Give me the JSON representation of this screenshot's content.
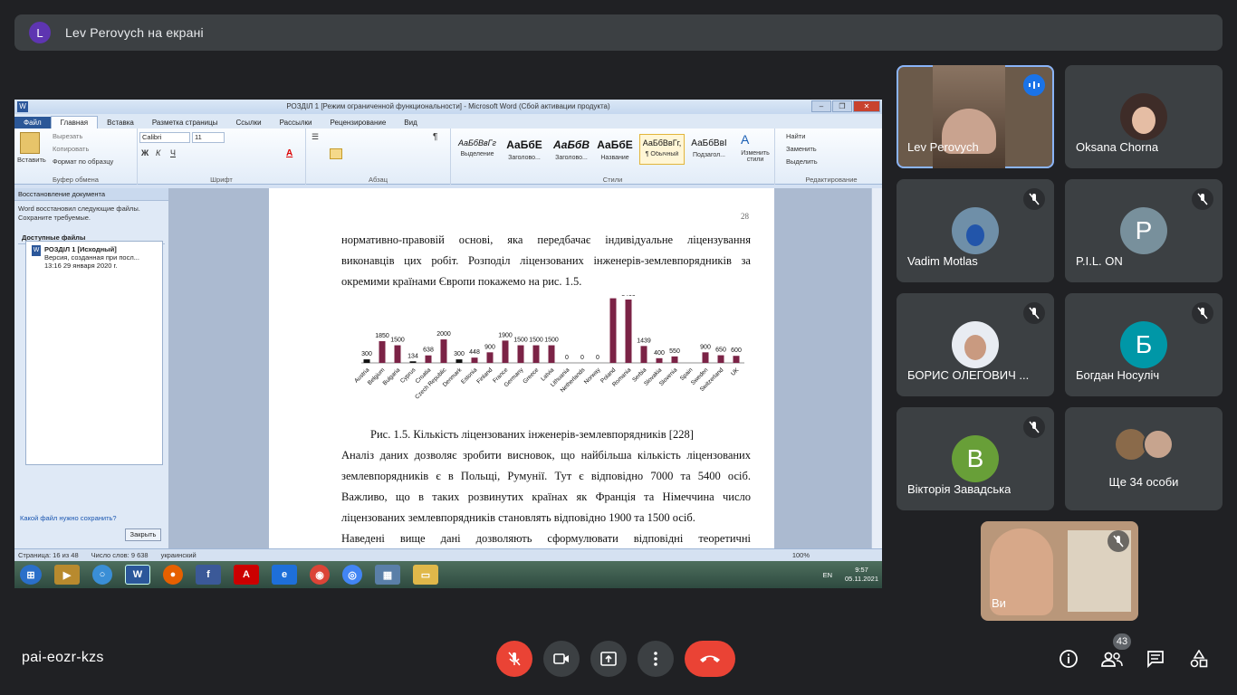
{
  "presenter": {
    "initial": "L",
    "text": "Lev Perovych на екрані"
  },
  "window": {
    "title": "РОЗДІЛ 1 [Режим ограниченной функциональности] - Microsoft Word (Сбой активации продукта)",
    "tabs": [
      "Файл",
      "Главная",
      "Вставка",
      "Разметка страницы",
      "Ссылки",
      "Рассылки",
      "Рецензирование",
      "Вид"
    ],
    "clipboard": {
      "paste": "Вставить",
      "cut": "Вырезать",
      "copy": "Копировать",
      "format": "Формат по образцу",
      "label": "Буфер обмена"
    },
    "font": {
      "name": "Calibri",
      "size": "11",
      "label": "Шрифт"
    },
    "paragraph_label": "Абзац",
    "styles": [
      {
        "preview": "АаБбВвГг",
        "name": "Выделение"
      },
      {
        "preview": "АаБбЕ",
        "name": "Заголово..."
      },
      {
        "preview": "АаБбВ",
        "name": "Заголово..."
      },
      {
        "preview": "АаБбЕ",
        "name": "Название"
      },
      {
        "preview": "АаБбВвГг,",
        "name": "¶ Обычный"
      },
      {
        "preview": "АаБбВвІ",
        "name": "Подзагол..."
      }
    ],
    "styles_label": "Стили",
    "change_styles": "Изменить стили",
    "editing": {
      "find": "Найти",
      "replace": "Заменить",
      "select": "Выделить",
      "label": "Редактирование"
    },
    "recovery": {
      "header": "Восстановление документа",
      "message": "Word восстановил следующие файлы. Сохраните требуемые.",
      "available": "Доступные файлы",
      "file_name": "РОЗДІЛ 1  [Исходный]",
      "file_desc": "Версия, созданная при посл...",
      "file_time": "13:16 29 января 2020 г.",
      "question": "Какой файл нужно сохранить?",
      "close": "Закрыть"
    },
    "document": {
      "page_number": "28",
      "lines_top": [
        "нормативно-правовій основі, яка передбачає індивідуальне ліцензування",
        "виконавців цих робіт. Розподіл ліцензованих інженерів-землевпорядників за",
        "окремими країнами Європи покажемо на рис. 1.5."
      ],
      "caption": "Рис. 1.5. Кількість ліцензованих інженерів-землевпорядників [228]",
      "lines_bottom": [
        "Аналіз даних дозволяє зробити висновок, що найбільша кількість ліцензованих",
        "землевпорядників є в Польщі, Румунії. Тут є відповідно 7000 та 5400 осіб.",
        "Важливо, що в таких розвинутих країнах як Франція та Німеччина число",
        "ліцензованих землевпорядників становлять відповідно 1900 та 1500 осіб.",
        "Наведені вище дані дозволяють сформулювати відповідні теоретичні"
      ]
    },
    "status": {
      "page": "Страница: 16 из 48",
      "words": "Число слов: 9 638",
      "lang": "украинский",
      "zoom": "100%"
    },
    "tray": {
      "lang": "EN",
      "time": "9:57",
      "date": "05.11.2021"
    }
  },
  "chart_data": {
    "type": "bar",
    "categories": [
      "Austria",
      "Belgium",
      "Bulgaria",
      "Cyprus",
      "Croatia",
      "Czech Republic",
      "Denmark",
      "Estonia",
      "Finland",
      "France",
      "Germany",
      "Greece",
      "Latvia",
      "Lithuania",
      "Netherlands",
      "Norway",
      "Poland",
      "Romania",
      "Serbia",
      "Slovakia",
      "Slovenia",
      "Spain",
      "Sweden",
      "Switzerland",
      "UK"
    ],
    "values": [
      300,
      1850,
      1500,
      134,
      638,
      2000,
      300,
      448,
      900,
      1900,
      1500,
      1500,
      1500,
      0,
      0,
      0,
      7000,
      5400,
      1439,
      400,
      550,
      null,
      900,
      650,
      600
    ],
    "labels": [
      "300",
      "1850",
      "1500",
      "134",
      "638",
      "2000",
      "300",
      "448",
      "900",
      "1900",
      "1500",
      "1500",
      "1500",
      "0",
      "0",
      "0",
      "",
      "5400",
      "1439",
      "400",
      "550",
      "",
      "900",
      "650",
      "600"
    ],
    "colors": {
      "bar": "#7b2346",
      "bar_dark": "#111111"
    },
    "xlabel": "",
    "ylabel": ""
  },
  "participants": [
    {
      "name": "Lev Perovych",
      "speaking": true
    },
    {
      "name": "Oksana Chorna"
    },
    {
      "name": "Vadim Motlas",
      "muted": true
    },
    {
      "name": "P.I.L. ON",
      "initial": "P",
      "color": "#78909c",
      "muted": true
    },
    {
      "name": "БОРИС ОЛЕГОВИЧ ...",
      "muted": true
    },
    {
      "name": "Богдан Носуліч",
      "initial": "Б",
      "color": "#0097a7",
      "muted": true
    },
    {
      "name": "Вікторія Завадська",
      "initial": "В",
      "color": "#689f38",
      "muted": true
    },
    {
      "name": "Ще 34 особи"
    }
  ],
  "self_view": {
    "name": "Ви"
  },
  "meeting": {
    "code": "pai-eozr-kzs",
    "people_count": "43"
  }
}
